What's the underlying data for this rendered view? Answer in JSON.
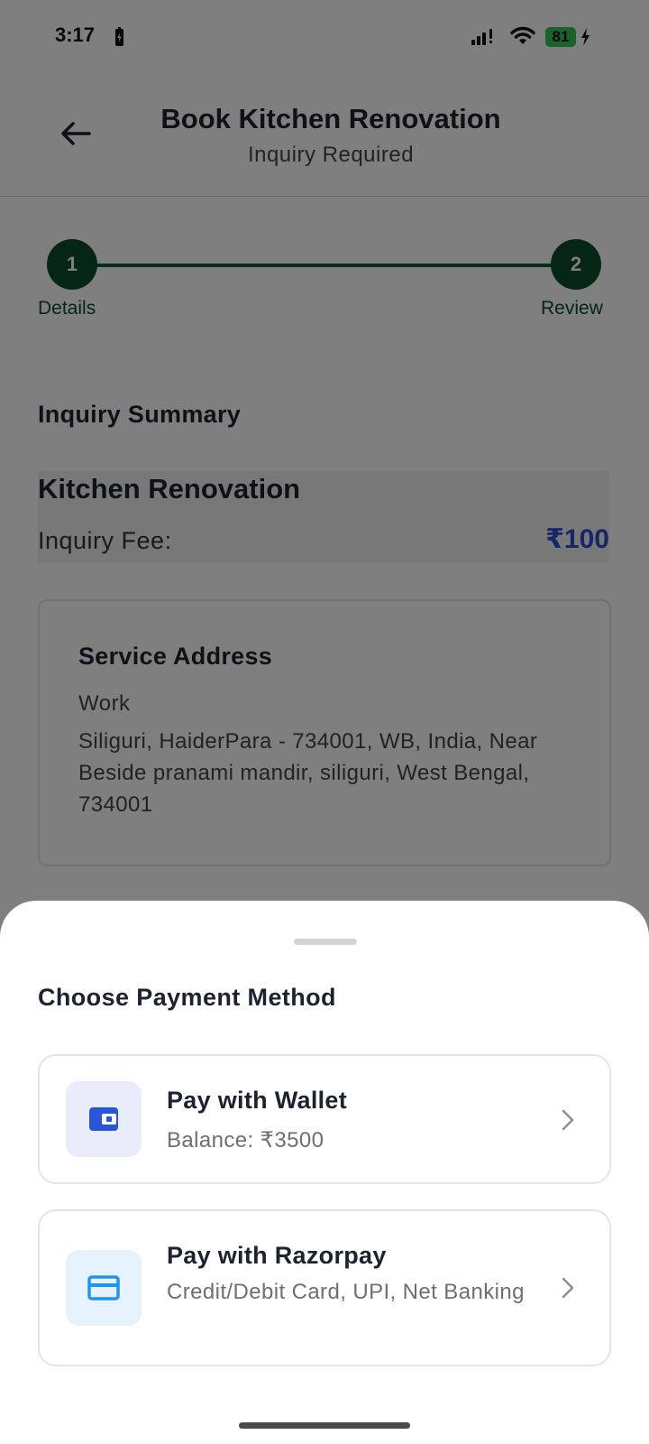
{
  "status_bar": {
    "time": "3:17",
    "battery_level": "81"
  },
  "header": {
    "title": "Book Kitchen Renovation",
    "subtitle": "Inquiry Required",
    "back_icon": "arrow-left-icon"
  },
  "stepper": {
    "steps": [
      {
        "number": "1",
        "label": "Details",
        "state": "completed"
      },
      {
        "number": "2",
        "label": "Review",
        "state": "active"
      }
    ],
    "color": "#0b4d2b"
  },
  "summary": {
    "section_title": "Inquiry Summary",
    "service_name": "Kitchen Renovation",
    "fee_label": "Inquiry Fee:",
    "fee_value": "₹100",
    "fee_color": "#2c4fd1"
  },
  "address": {
    "title": "Service Address",
    "type": "Work",
    "text": "Siliguri, HaiderPara - 734001, WB, India, Near Beside pranami mandir, siliguri, West Bengal, 734001"
  },
  "payment_sheet": {
    "title": "Choose Payment Method",
    "options": [
      {
        "title": "Pay with Wallet",
        "description": "Balance: ₹3500",
        "icon": "wallet-icon",
        "icon_color": "#2a55d6"
      },
      {
        "title": "Pay with Razorpay",
        "description": "Credit/Debit Card, UPI, Net Banking",
        "icon": "credit-card-icon",
        "icon_color": "#2196e8"
      }
    ]
  }
}
